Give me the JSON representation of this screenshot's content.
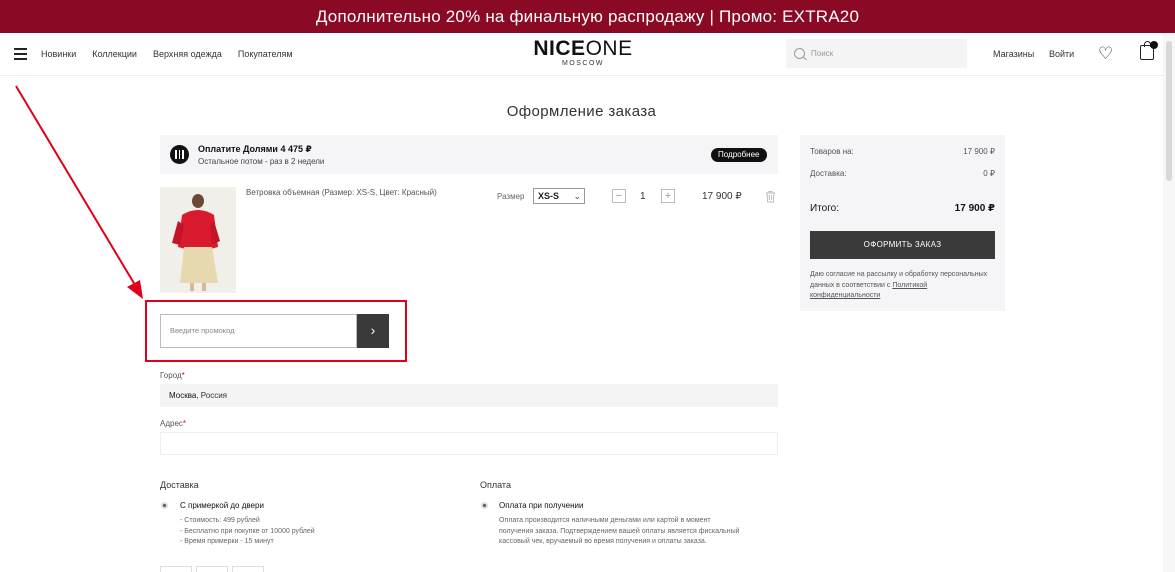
{
  "promo_bar": {
    "text": "Дополнительно 20% на финальную распродажу | Промо: EXTRA20",
    "color": "#8a0a25"
  },
  "header": {
    "nav": [
      "Новинки",
      "Коллекции",
      "Верхняя одежда",
      "Покупателям"
    ],
    "logo": {
      "part1": "NICE",
      "part2": "ONE",
      "sub": "MOSCOW"
    },
    "search_placeholder": "Поиск",
    "stores": "Магазины",
    "login": "Войти"
  },
  "page_title": "Оформление заказа",
  "dolyami": {
    "title": "Оплатите Долями 4 475 ₽",
    "subtitle": "Остальное потом - раз в 2 недели",
    "more": "Подробнее"
  },
  "cart_item": {
    "name": "Ветровка объемная (Размер: XS-S, Цвет: Красный)",
    "size_label": "Размер",
    "size_value": "XS-S",
    "qty_minus": "−",
    "qty": "1",
    "qty_plus": "+",
    "price": "17 900 ₽"
  },
  "promo": {
    "placeholder": "Введите промокод",
    "submit": "›"
  },
  "form": {
    "city_label": "Город",
    "city_value_bold": "Москва",
    "city_value_rest": ", Россия",
    "address_label": "Адрес",
    "required_mark": "*"
  },
  "delivery": {
    "title": "Доставка",
    "option": "С примеркой до двери",
    "details": [
      "- Стоимость: 499 рублей",
      "- Бесплатно при покупке от 10000 рублей",
      "- Время примерки - 15 минут"
    ]
  },
  "payment": {
    "title": "Оплата",
    "option": "Оплата при получении",
    "details": [
      "Оплата производится наличными деньгами или картой в момент",
      "получения заказа. Подтверждением вашей оплаты является фискальный",
      "кассовый чек, вручаемый во время получения и оплаты заказа."
    ]
  },
  "summary": {
    "goods_label": "Товаров на:",
    "goods_value": "17 900 ₽",
    "delivery_label": "Доставка:",
    "delivery_value": "0 ₽",
    "total_label": "Итого:",
    "total_value": "17 900 ₽",
    "checkout": "ОФОРМИТЬ ЗАКАЗ",
    "consent_text": "Даю согласие на рассылку и обработку персональных данных в соответствии с",
    "consent_link": "Политикой конфиденциальности"
  },
  "annotation_color": "#e0001a"
}
